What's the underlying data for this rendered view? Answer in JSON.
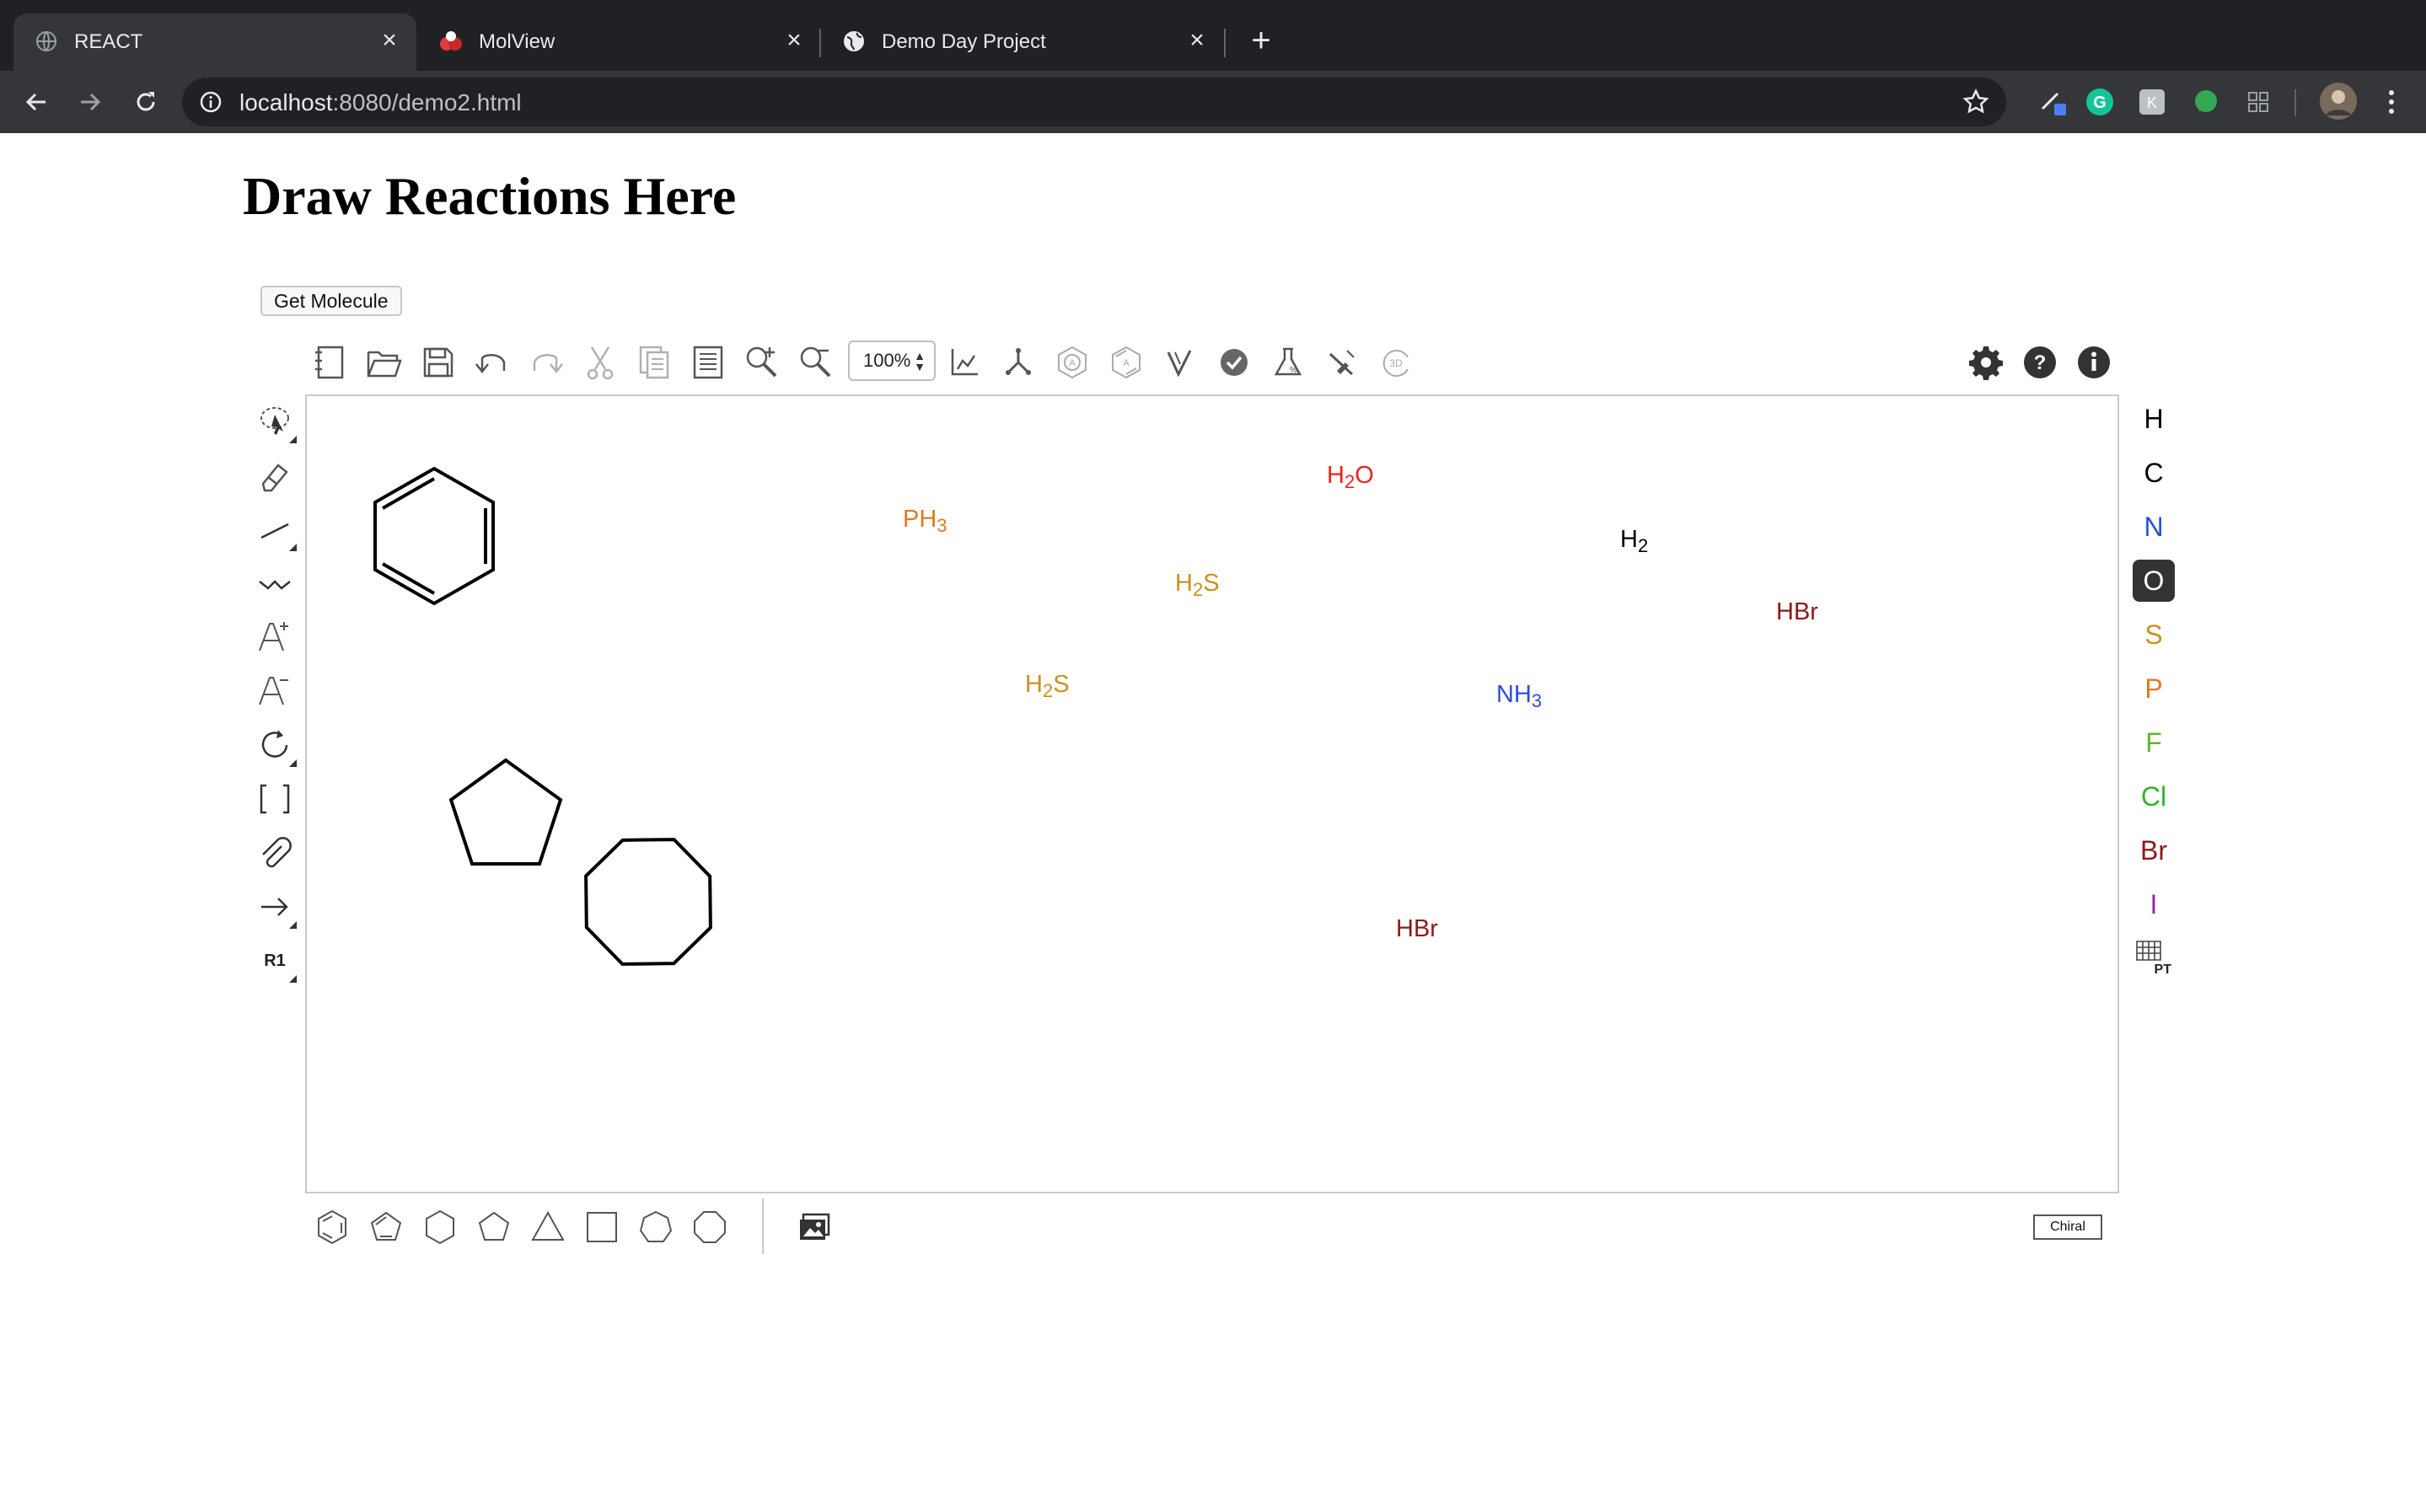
{
  "browser": {
    "tabs": [
      {
        "title": "REACT",
        "active": true
      },
      {
        "title": "MolView",
        "active": false
      },
      {
        "title": "Demo Day Project",
        "active": false
      }
    ],
    "url_host": "localhost",
    "url_path": ":8080/demo2.html"
  },
  "page": {
    "heading": "Draw Reactions Here",
    "get_molecule_label": "Get Molecule"
  },
  "editor": {
    "zoom_value": "100%",
    "top_tools": [
      "clear-canvas",
      "open",
      "save",
      "undo",
      "redo",
      "cut",
      "copy",
      "paste",
      "zoom-in",
      "zoom-out",
      "zoom-select",
      "layout",
      "clean-up",
      "aromatize",
      "dearomatize",
      "calculate",
      "check",
      "analyse",
      "stereochemistry",
      "3d-viewer",
      "settings",
      "help",
      "about"
    ],
    "left_tools": [
      "select-lasso",
      "erase",
      "single-bond",
      "chain",
      "charge-plus",
      "charge-minus",
      "rotate",
      "sgroup-bracket",
      "attachment-point",
      "reaction-arrow",
      "rgroup-label"
    ],
    "r1_label": "R1",
    "canvas_formulas": [
      {
        "text": "H2O",
        "parts": [
          [
            "H",
            false
          ],
          [
            "2",
            true
          ],
          [
            "O",
            false
          ]
        ],
        "color": "#e8231c"
      },
      {
        "text": "PH3",
        "parts": [
          [
            "PH",
            false
          ],
          [
            "3",
            true
          ]
        ],
        "color": "#e07a1e"
      },
      {
        "text": "H2",
        "parts": [
          [
            "H",
            false
          ],
          [
            "2",
            true
          ]
        ],
        "color": "#000000"
      },
      {
        "text": "H2S",
        "parts": [
          [
            "H",
            false
          ],
          [
            "2",
            true
          ],
          [
            "S",
            false
          ]
        ],
        "color": "#c9921c"
      },
      {
        "text": "HBr",
        "parts": [
          [
            "HBr",
            false
          ]
        ],
        "color": "#8b1a1a"
      },
      {
        "text": "H2S",
        "parts": [
          [
            "H",
            false
          ],
          [
            "2",
            true
          ],
          [
            "S",
            false
          ]
        ],
        "color": "#c9921c"
      },
      {
        "text": "NH3",
        "parts": [
          [
            "NH",
            false
          ],
          [
            "3",
            true
          ]
        ],
        "color": "#2c4fd6"
      },
      {
        "text": "HBr",
        "parts": [
          [
            "HBr",
            false
          ]
        ],
        "color": "#8b1a1a"
      }
    ],
    "atoms": [
      {
        "symbol": "H",
        "color": "#000000",
        "selected": false
      },
      {
        "symbol": "C",
        "color": "#000000",
        "selected": false
      },
      {
        "symbol": "N",
        "color": "#2c4fd6",
        "selected": false
      },
      {
        "symbol": "O",
        "color": "#ffffff",
        "selected": true
      },
      {
        "symbol": "S",
        "color": "#c9921c",
        "selected": false
      },
      {
        "symbol": "P",
        "color": "#e07a1e",
        "selected": false
      },
      {
        "symbol": "F",
        "color": "#5cb82e",
        "selected": false
      },
      {
        "symbol": "Cl",
        "color": "#2fb52f",
        "selected": false
      },
      {
        "symbol": "Br",
        "color": "#8b1a1a",
        "selected": false
      },
      {
        "symbol": "I",
        "color": "#8a2a9e",
        "selected": false
      }
    ],
    "periodic_table_label": "PT",
    "bottom_tools": [
      "benzene-template",
      "cyclopentadiene-template",
      "cyclohexane-template",
      "cyclopentane-template",
      "cyclopropane-template",
      "cyclobutane-template",
      "cycloheptane-template",
      "cyclooctane-template",
      "template-library"
    ],
    "chiral_label": "Chiral"
  }
}
